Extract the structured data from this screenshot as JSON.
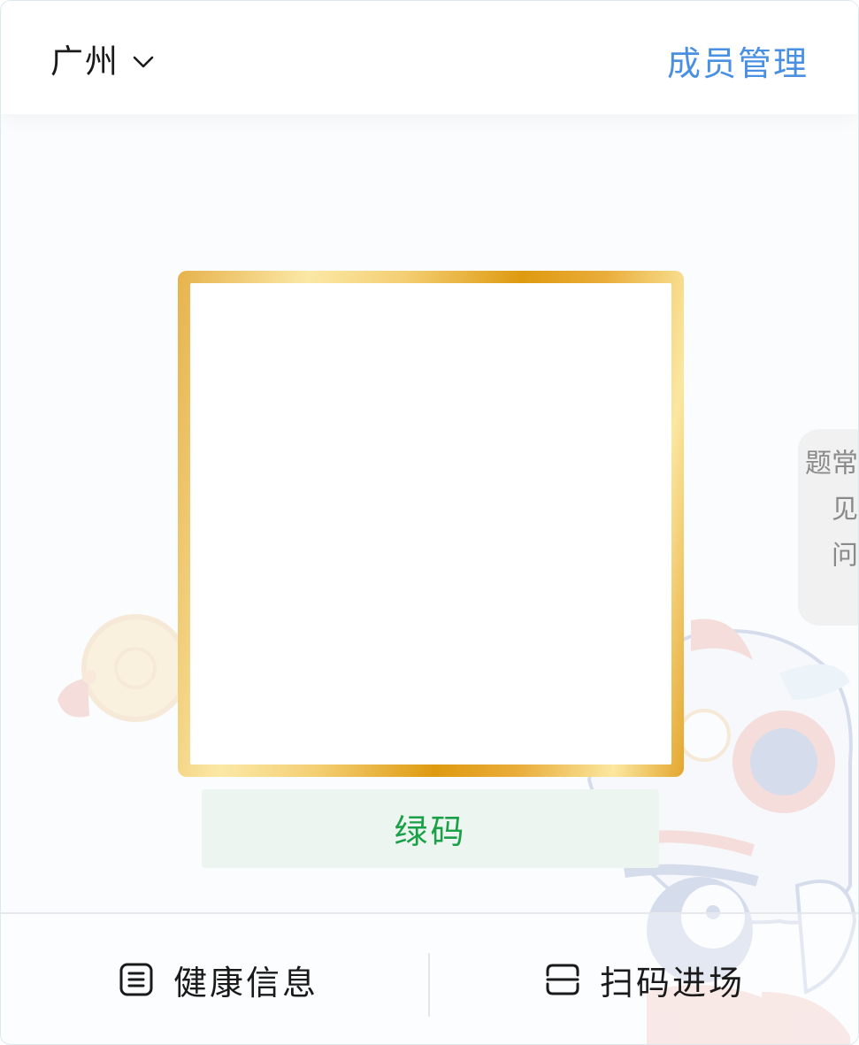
{
  "header": {
    "city": "广州",
    "members_link": "成员管理"
  },
  "code": {
    "status_label": "绿码",
    "status_color": "#1aa047",
    "frame_color": "#de9a10"
  },
  "side_tab": {
    "label": "常见问题"
  },
  "bottom_bar": {
    "health_label": "健康信息",
    "scan_label": "扫码进场"
  },
  "colors": {
    "link": "#4a90e2",
    "status_bg": "#ecf5f0"
  }
}
